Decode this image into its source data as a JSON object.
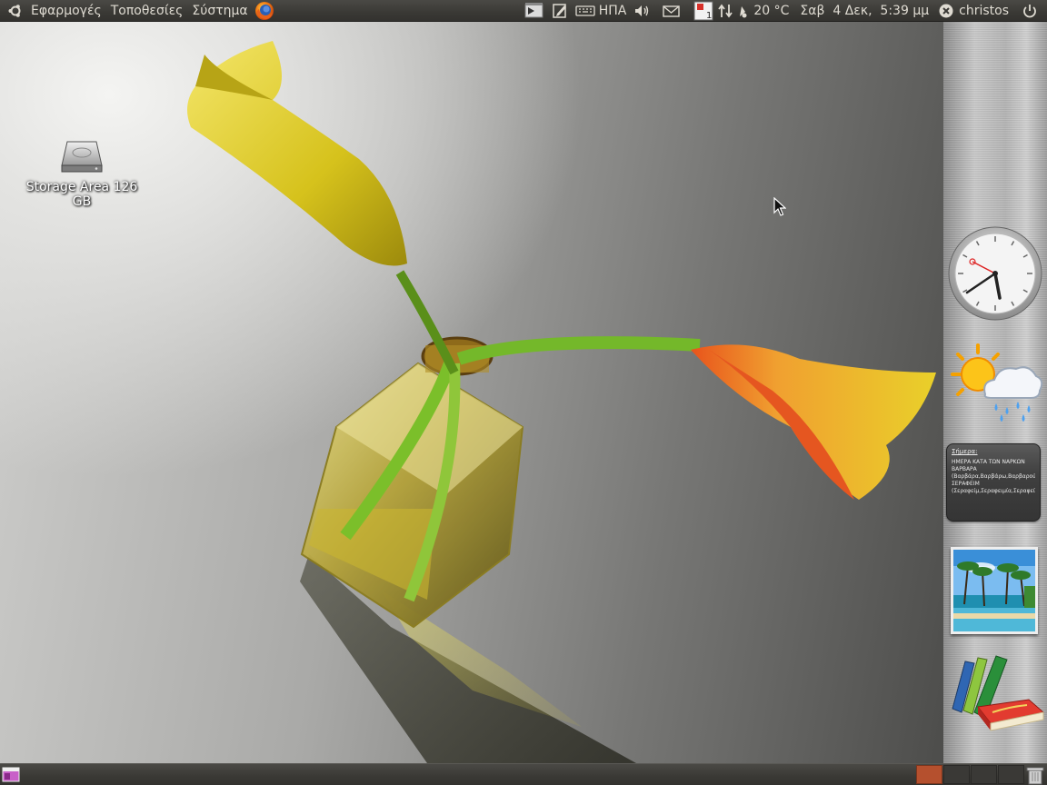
{
  "top_panel": {
    "menus": [
      "Εφαρμογές",
      "Τοποθεσίες",
      "Σύστημα"
    ],
    "keyboard_layout": "ΗΠΑ",
    "workspace_indicator": "1",
    "temperature": "20 °C",
    "datetime": "Σαβ  4 Δεκ,  5:39 μμ",
    "username": "christos"
  },
  "desktop": {
    "icons": [
      {
        "label": "Storage Area 126 GB",
        "icon": "hard-drive-icon"
      }
    ]
  },
  "dock": {
    "calendar": {
      "title": "Σήμερα:",
      "lines": [
        "ΗΜΕΡΑ ΚΑΤΑ ΤΩΝ ΝΑΡΚΩΝ",
        "ΒΑΡΒΑΡΑ",
        "(Βαρβάρα,Βαρβάρω,Βαρβαρούλα,Ρούλα",
        "ΣΕΡΑΦΕΙΜ",
        "(Σεραφείμ,Σεραφειμία,Σεραφείμα,Σερ"
      ]
    }
  },
  "bottom_panel": {
    "workspaces": 4,
    "active_workspace": 1
  },
  "colors": {
    "panel": "#3c3b37",
    "workspace_active": "#b5502e",
    "flower_yellow": "#e8d436",
    "stem_green": "#6aa81e"
  }
}
